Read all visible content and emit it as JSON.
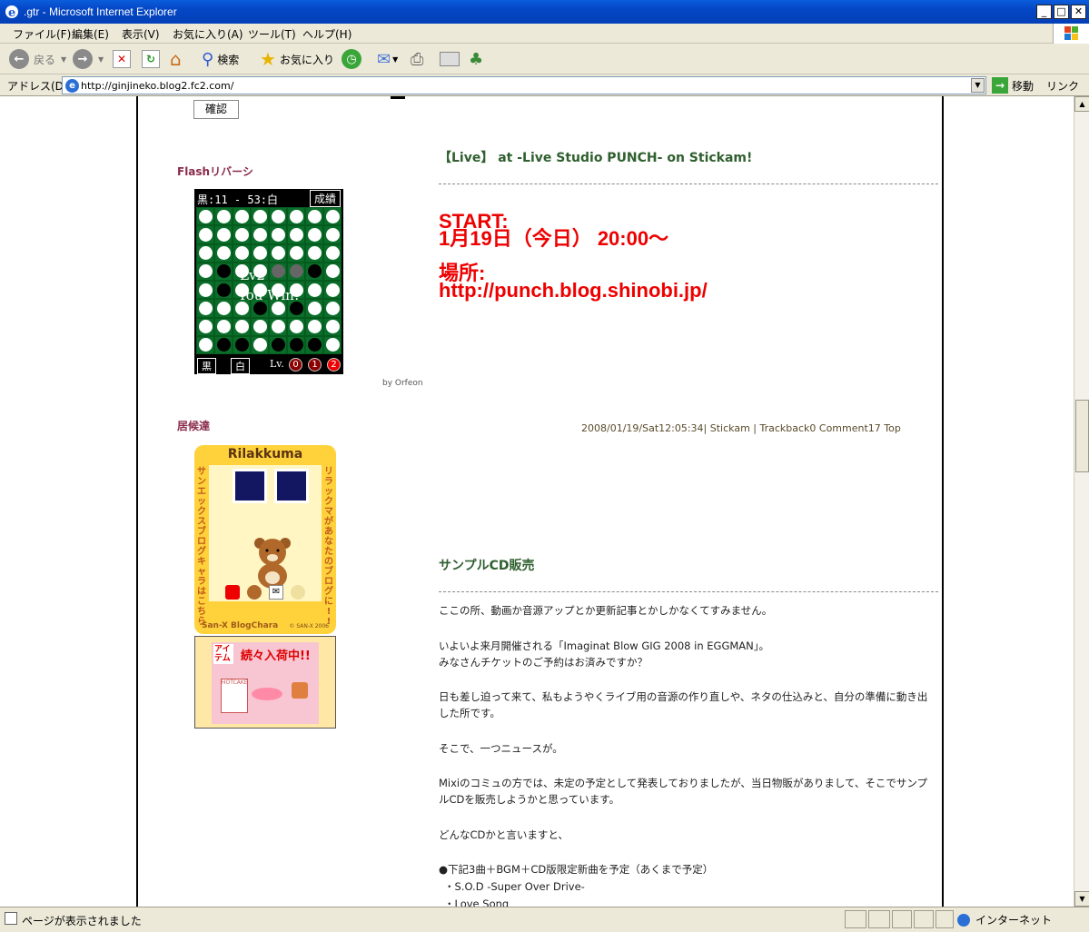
{
  "window": {
    "title": ".gtr - Microsoft Internet Explorer"
  },
  "menu": [
    "ファイル(F)",
    "編集(E)",
    "表示(V)",
    "お気に入り(A)",
    "ツール(T)",
    "ヘルプ(H)"
  ],
  "toolbar": {
    "back_label": "戻る",
    "search_label": "検索",
    "favorites_label": "お気に入り"
  },
  "address": {
    "label": "アドレス(D)",
    "url": "http://ginjineko.blog2.fc2.com/",
    "go_label": "移動",
    "links_label": "リンク"
  },
  "sidebar": {
    "confirm_label": "確認",
    "reversi_heading": "Flashリバーシ",
    "reversi": {
      "score": "黒:11 - 53:白",
      "results_label": "成績",
      "message_level": "Lv2",
      "message_result": "You Win!",
      "black_label": "黒",
      "white_label": "白",
      "level_label": "Lv.",
      "levels": [
        "0",
        "1",
        "2"
      ],
      "selected_level": 2,
      "board": [
        "WWWWWWWW",
        "WWWWWWWW",
        "WWWWWWWW",
        "WBWWGGBW",
        "WBWWWWWW",
        "WWWBWBWW",
        "WWWWWWWW",
        "WBBWBBBW"
      ]
    },
    "byline": "by Orfeon",
    "residents_heading": "居候達",
    "rilakkuma": {
      "title": "Rilakkuma",
      "left_text": "サンエックスブログキャラはこちら",
      "right_text": "リラックマがあなたのブログに!!",
      "footer": "San-X BlogChara",
      "copyright": "© SAN-X 2006"
    },
    "item_banner": {
      "tag": "アイテム",
      "headline": "続々入荷中!!",
      "product": "HOTCAKE"
    }
  },
  "post1": {
    "title": "【Live】 at -Live Studio PUNCH- on Stickam!",
    "line1": "START:",
    "line2": "1月19日（今日） 20:00〜",
    "line3": "場所:",
    "line4": "http://punch.blog.shinobi.jp/",
    "meta": "2008/01/19/Sat12:05:34| Stickam | Trackback0 Comment17 Top"
  },
  "post2": {
    "title": "サンプルCD販売",
    "paragraphs": [
      "ここの所、動画か音源アップとか更新記事とかしかなくてすみません。",
      "いよいよ来月開催される「Imaginat Blow GIG 2008 in EGGMAN」。",
      "みなさんチケットのご予約はお済みですか？",
      "日も差し迫って来て、私もようやくライブ用の音源の作り直しや、ネタの仕込みと、自分の準備に動き出した所です。",
      "そこで、一つニュースが。",
      "Mixiのコミュの方では、未定の予定として発表しておりましたが、当日物販がありまして、そこでサンプルCDを販売しようかと思っています。",
      "どんなCDかと言いますと、",
      "●下記3曲＋BGM＋CD版限定新曲を予定（あくまで予定）",
      "・S.O.D -Super Over Drive-",
      "・Love Song"
    ]
  },
  "status": {
    "text": "ページが表示されました",
    "zone": "インターネット"
  },
  "colors": {
    "titlebar": "#0546c5",
    "post_title": "#2f5f2f",
    "sidebar_heading": "#8a2a4a",
    "highlight_red": "#e00000"
  }
}
